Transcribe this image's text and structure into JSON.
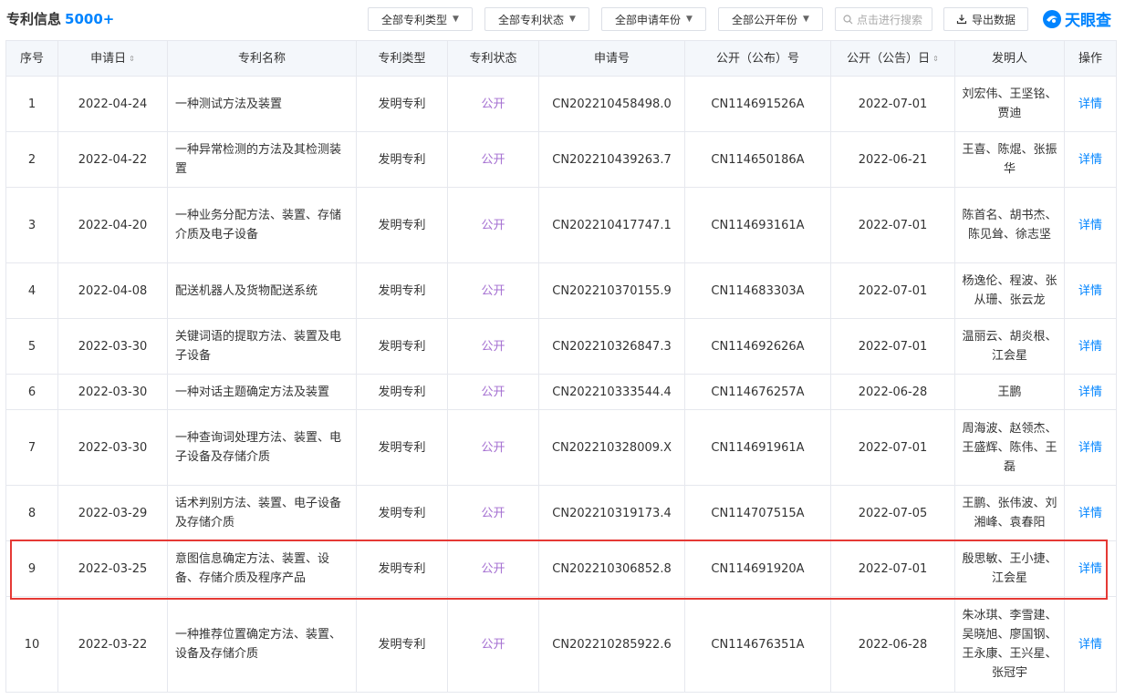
{
  "header": {
    "title": "专利信息",
    "count": "5000+",
    "filters": [
      "全部专利类型",
      "全部专利状态",
      "全部申请年份",
      "全部公开年份"
    ],
    "search_placeholder": "点击进行搜索",
    "export_label": "导出数据",
    "brand": "天眼查"
  },
  "table": {
    "columns": [
      "序号",
      "申请日",
      "专利名称",
      "专利类型",
      "专利状态",
      "申请号",
      "公开（公布）号",
      "公开（公告）日",
      "发明人",
      "操作"
    ],
    "rows": [
      {
        "no": "1",
        "date": "2022-04-24",
        "name": "一种测试方法及装置",
        "type": "发明专利",
        "status": "公开",
        "app_no": "CN202210458498.0",
        "pub_no": "CN114691526A",
        "pub_date": "2022-07-01",
        "inventors": "刘宏伟、王坚铭、贾迪",
        "op": "详情"
      },
      {
        "no": "2",
        "date": "2022-04-22",
        "name": "一种异常检测的方法及其检测装置",
        "type": "发明专利",
        "status": "公开",
        "app_no": "CN202210439263.7",
        "pub_no": "CN114650186A",
        "pub_date": "2022-06-21",
        "inventors": "王喜、陈焜、张振华",
        "op": "详情"
      },
      {
        "no": "3",
        "date": "2022-04-20",
        "name": "一种业务分配方法、装置、存储介质及电子设备",
        "type": "发明专利",
        "status": "公开",
        "app_no": "CN202210417747.1",
        "pub_no": "CN114693161A",
        "pub_date": "2022-07-01",
        "inventors": "陈首名、胡书杰、陈见耸、徐志坚",
        "op": "详情"
      },
      {
        "no": "4",
        "date": "2022-04-08",
        "name": "配送机器人及货物配送系统",
        "type": "发明专利",
        "status": "公开",
        "app_no": "CN202210370155.9",
        "pub_no": "CN114683303A",
        "pub_date": "2022-07-01",
        "inventors": "杨逸伦、程波、张从珊、张云龙",
        "op": "详情"
      },
      {
        "no": "5",
        "date": "2022-03-30",
        "name": "关键词语的提取方法、装置及电子设备",
        "type": "发明专利",
        "status": "公开",
        "app_no": "CN202210326847.3",
        "pub_no": "CN114692626A",
        "pub_date": "2022-07-01",
        "inventors": "温丽云、胡炎根、江会星",
        "op": "详情"
      },
      {
        "no": "6",
        "date": "2022-03-30",
        "name": "一种对话主题确定方法及装置",
        "type": "发明专利",
        "status": "公开",
        "app_no": "CN202210333544.4",
        "pub_no": "CN114676257A",
        "pub_date": "2022-06-28",
        "inventors": "王鹏",
        "op": "详情"
      },
      {
        "no": "7",
        "date": "2022-03-30",
        "name": "一种查询词处理方法、装置、电子设备及存储介质",
        "type": "发明专利",
        "status": "公开",
        "app_no": "CN202210328009.X",
        "pub_no": "CN114691961A",
        "pub_date": "2022-07-01",
        "inventors": "周海波、赵领杰、王盛辉、陈伟、王磊",
        "op": "详情"
      },
      {
        "no": "8",
        "date": "2022-03-29",
        "name": "话术判别方法、装置、电子设备及存储介质",
        "type": "发明专利",
        "status": "公开",
        "app_no": "CN202210319173.4",
        "pub_no": "CN114707515A",
        "pub_date": "2022-07-05",
        "inventors": "王鹏、张伟波、刘湘峰、袁春阳",
        "op": "详情"
      },
      {
        "no": "9",
        "date": "2022-03-25",
        "name": "意图信息确定方法、装置、设备、存储介质及程序产品",
        "type": "发明专利",
        "status": "公开",
        "app_no": "CN202210306852.8",
        "pub_no": "CN114691920A",
        "pub_date": "2022-07-01",
        "inventors": "殷思敏、王小捷、江会星",
        "op": "详情"
      },
      {
        "no": "10",
        "date": "2022-03-22",
        "name": "一种推荐位置确定方法、装置、设备及存储介质",
        "type": "发明专利",
        "status": "公开",
        "app_no": "CN202210285922.6",
        "pub_no": "CN114676351A",
        "pub_date": "2022-06-28",
        "inventors": "朱冰琪、李雪建、吴晓旭、廖国钢、王永康、王兴星、张冠宇",
        "op": "详情"
      }
    ]
  }
}
